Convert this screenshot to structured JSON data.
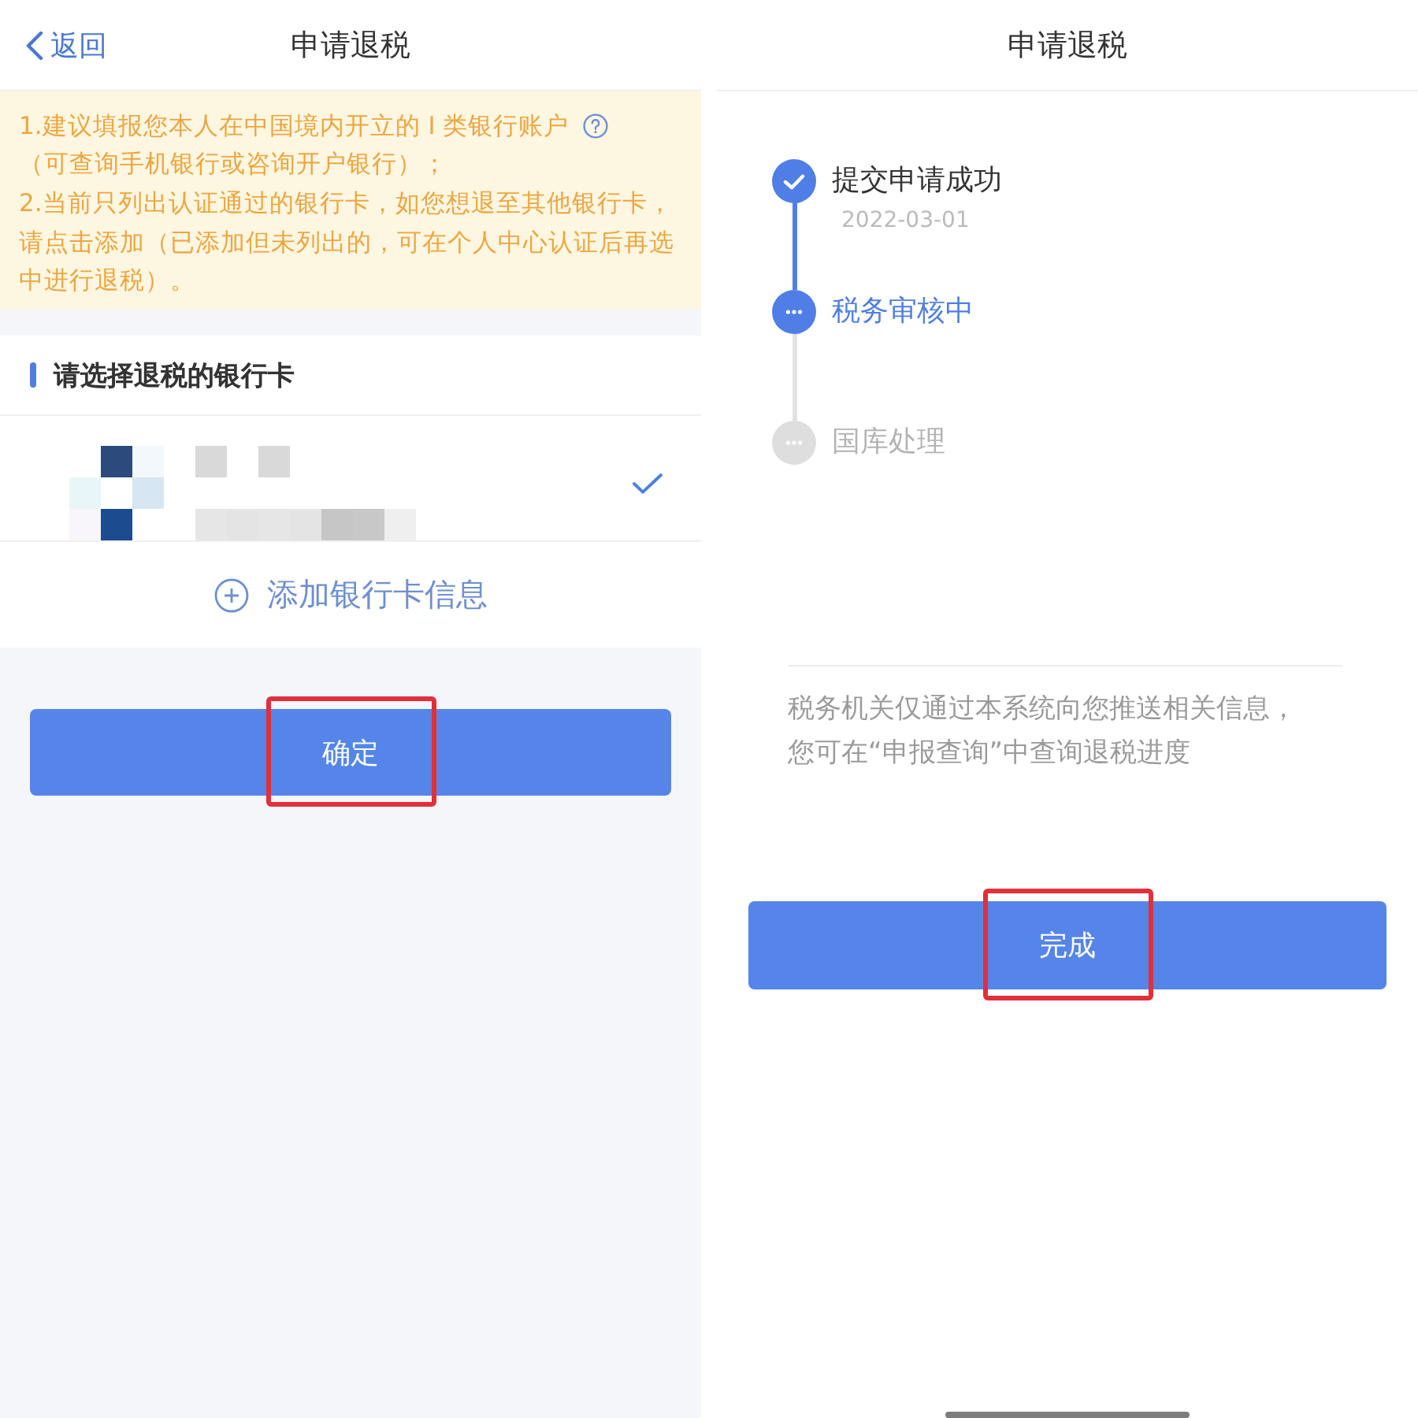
{
  "left_screen": {
    "header": {
      "back_label": "返回",
      "title": "申请退税"
    },
    "notice": {
      "items": [
        {
          "text": "1.建议填报您本人在中国境内开立的 I 类银行账户",
          "help_icon": true,
          "note": "（可查询手机银行或咨询开户银行）；"
        },
        {
          "text": "2.当前只列出认证通过的银行卡，如您想退至其他银行卡，请点击添加（已添加但未列出的，可在个人中心认证后再选中进行退税）。",
          "help_icon": false
        }
      ]
    },
    "section_title": "请选择退税的银行卡",
    "bank_cards": [
      {
        "selected": true
      }
    ],
    "add_card": "添加银行卡信息",
    "confirm_button": {
      "label": "确定",
      "highlighted": true
    }
  },
  "right_screen": {
    "header": {
      "title": "申请退税"
    },
    "steps": [
      {
        "label": "提交申请成功",
        "date": "2022-03-01",
        "kind": "done"
      },
      {
        "label": "税务审核中",
        "kind": "current"
      },
      {
        "label": "国库处理",
        "kind": "pending"
      }
    ],
    "notice": "税务机关仅通过本系统向您推送相关信息，您可在“申报查询”中查询退税进度",
    "done_button": {
      "label": "完成",
      "highlighted": true
    }
  }
}
